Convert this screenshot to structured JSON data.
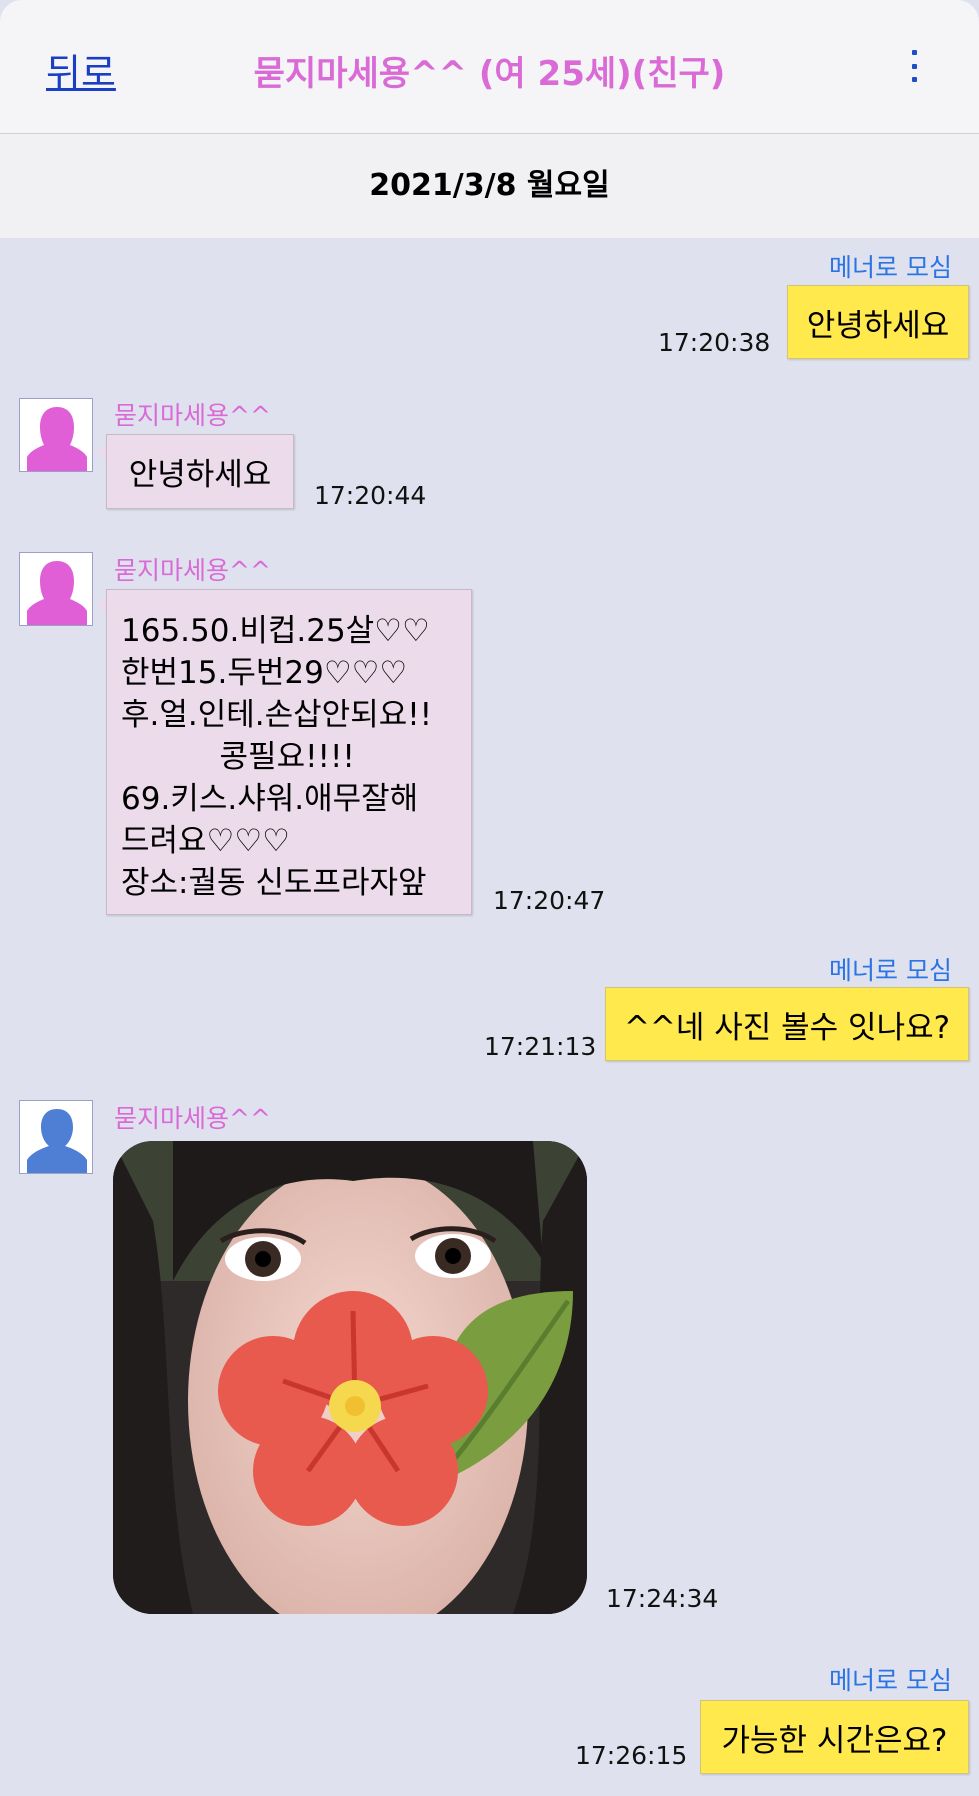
{
  "header": {
    "back_label": "뒤로",
    "title": "묻지마세용^^ (여 25세)(친구)",
    "menu_icon": "vertical-dots-icon"
  },
  "date": "2021/3/8 월요일",
  "messages": [
    {
      "side": "out",
      "note": "메너로 모심",
      "text": "안녕하세요",
      "time": "17:20:38"
    },
    {
      "side": "in",
      "avatar": "female-avatar-icon",
      "name": "묻지마세용^^",
      "text": "안녕하세요",
      "time": "17:20:44"
    },
    {
      "side": "in",
      "avatar": "female-avatar-icon",
      "name": "묻지마세용^^",
      "text": "165.50.비컵.25살♡♡\n한번15.두번29♡♡♡\n후.얼.인테.손삽안되요!!\n          콩필요!!!!\n69.키스.샤워.애무잘해\n드려요♡♡♡\n장소:궐동 신도프라자앞",
      "time": "17:20:47"
    },
    {
      "side": "out",
      "note": "메너로 모심",
      "text": "^^네 사진 볼수 잇나요?",
      "time": "17:21:13"
    },
    {
      "side": "in",
      "avatar": "male-avatar-icon",
      "name": "묻지마세용^^",
      "image": "photo-with-flower-sticker",
      "time": "17:24:34"
    },
    {
      "side": "out",
      "note": "메너로 모심",
      "text": "가능한 시간은요?",
      "time": "17:26:15"
    }
  ],
  "colors": {
    "accent_pink": "#d96ad6",
    "link_blue": "#1a3fc4",
    "note_blue": "#2a74e6",
    "bubble_yellow": "#ffe94d",
    "bubble_pink": "#ecdbea",
    "background": "#dfe2ee"
  }
}
